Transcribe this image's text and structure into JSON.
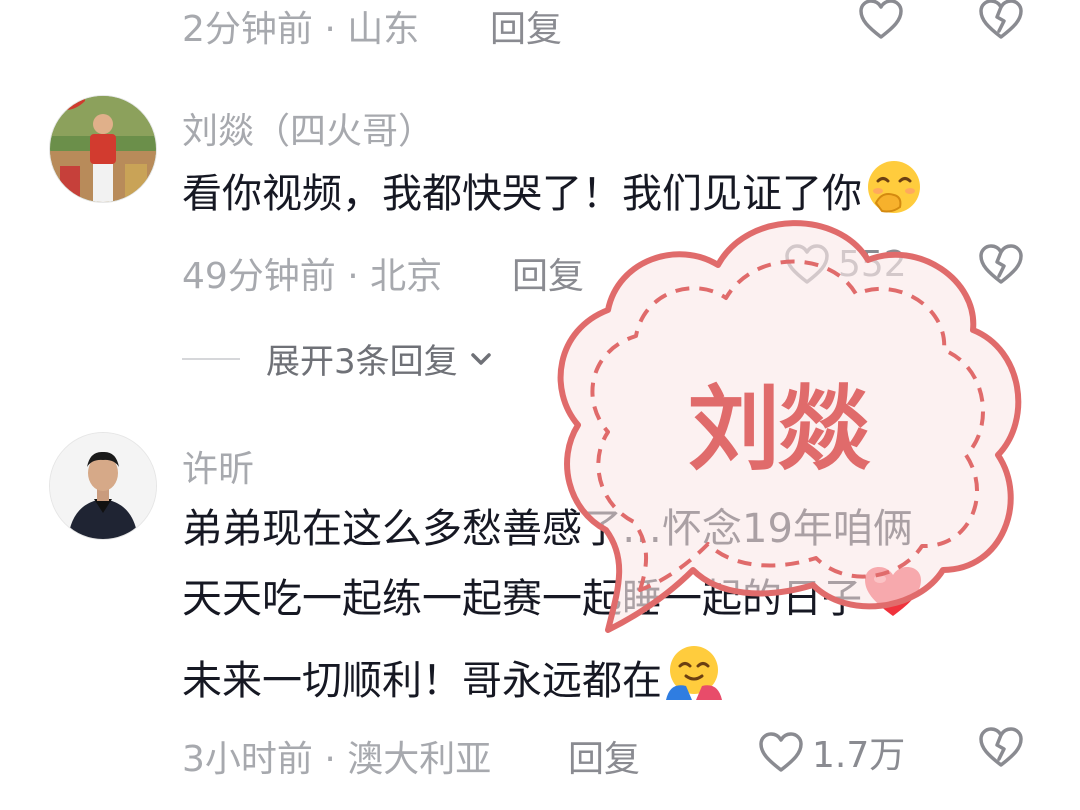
{
  "comment_top": {
    "meta": "2分钟前 · 山东",
    "reply_label": "回复"
  },
  "comment_liu": {
    "author": "刘燚（四火哥）",
    "text": "看你视频，我都快哭了！我们见证了你",
    "time_location": "49分钟前 · 北京",
    "reply_label": "回复",
    "like_count": "552",
    "expand_replies": "展开3条回复"
  },
  "comment_xu": {
    "author": "许昕",
    "lines": [
      "弟弟现在这么多愁善感了…怀念19年咱俩",
      "天天吃一起练一起赛一起睡一起的日子",
      "未来一切顺利！哥永远都在"
    ],
    "time_location": "3小时前 · 澳大利亚",
    "reply_label": "回复",
    "like_count": "1.7万"
  },
  "stamp": {
    "text": "刘燚"
  },
  "icons": {
    "like": "heart-outline-icon",
    "dislike": "broken-heart-icon",
    "expand": "chevron-down-icon",
    "emoji_blush": "smiling-face-hand-over-mouth-emoji",
    "emoji_heart": "red-heart-emoji",
    "emoji_hug": "hugging-face-emoji"
  },
  "colors": {
    "stamp": "#e06b6b",
    "muted_text": "#a7a9ae",
    "primary_text": "#161823"
  }
}
